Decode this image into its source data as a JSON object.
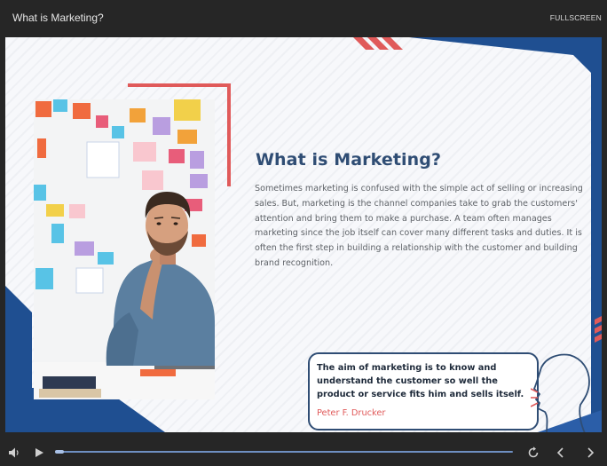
{
  "window": {
    "title": "What is Marketing?",
    "fullscreen_label": "FULLSCREEN"
  },
  "slide": {
    "title": "What is Marketing?",
    "body": "Sometimes marketing is confused with the simple act of selling or increasing sales. But, marketing is the channel companies take to grab the customers' attention and bring them to make a purchase. A team often manages marketing since the job itself can cover many different tasks and duties. It is often the first step in building a relationship with the customer and building brand recognition.",
    "quote": {
      "text": "The aim of marketing is to know and understand the customer so well the product or service fits him and sells itself.",
      "author": "Peter F. Drucker"
    }
  },
  "player": {
    "progress": 0.02
  },
  "colors": {
    "navy": "#2f4d74",
    "red": "#e05a5a",
    "blue": "#1f4f91",
    "bar": "#262626"
  },
  "icons": [
    "volume-icon",
    "play-icon",
    "replay-icon",
    "previous-icon",
    "next-icon",
    "man-thinking-photo",
    "profile-head-icon"
  ]
}
